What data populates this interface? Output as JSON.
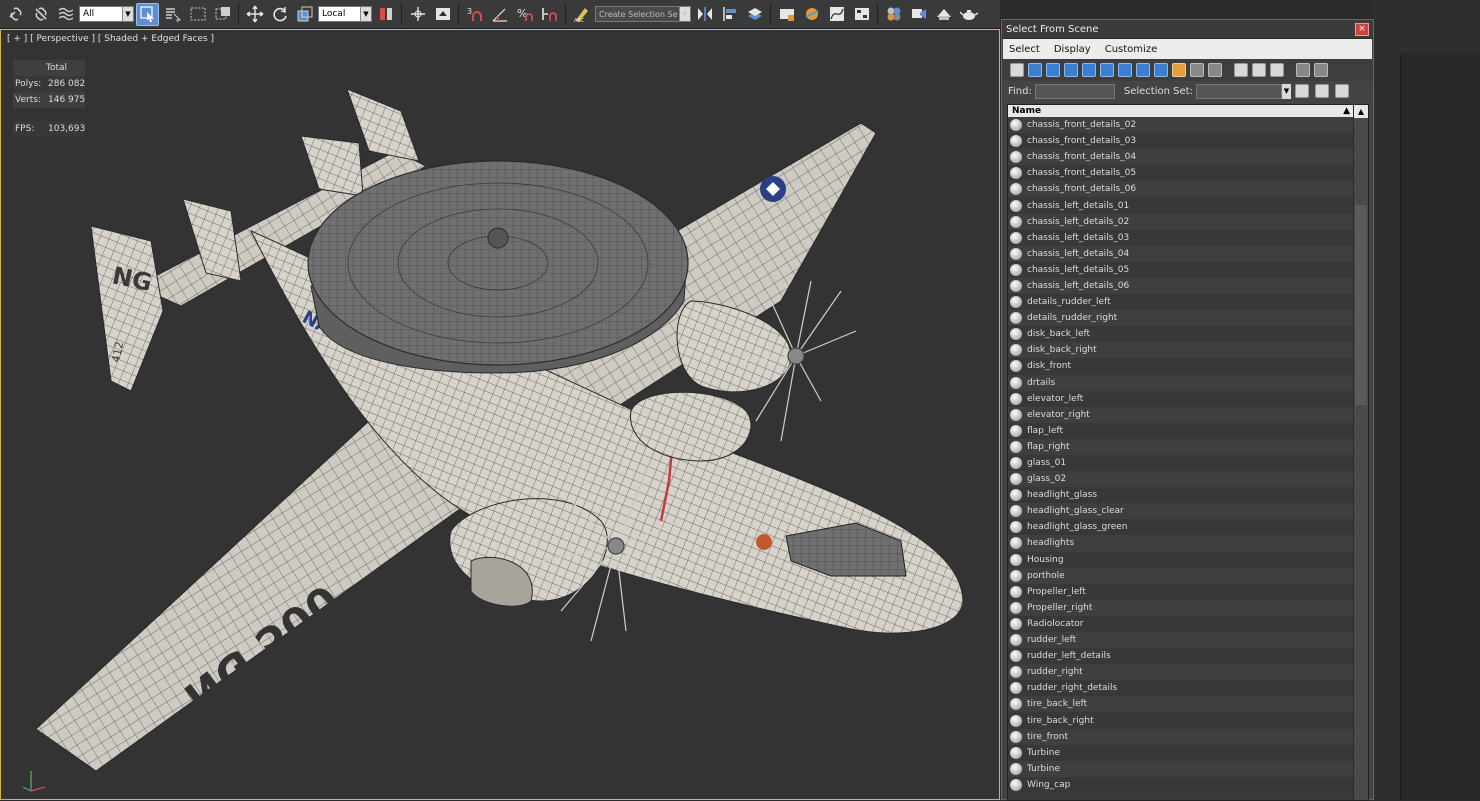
{
  "toolbar": {
    "filter_value": "All",
    "coord_system": "Local",
    "snap_label": "3",
    "selection_set_placeholder": "Create Selection Se"
  },
  "viewport": {
    "label": "[ + ] [ Perspective ] [ Shaded + Edged Faces ]",
    "stats": {
      "total_label": "Total",
      "polys_label": "Polys:",
      "polys_value": "286 082",
      "verts_label": "Verts:",
      "verts_value": "146 975",
      "fps_label": "FPS:",
      "fps_value": "103,693"
    },
    "decals": {
      "tail_code": "NG",
      "tail_number": "412",
      "wing_code": "NG 500",
      "fuselage_text": "NAVY"
    }
  },
  "dialog": {
    "title": "Select From Scene",
    "close": "×",
    "menu": [
      "Select",
      "Display",
      "Customize"
    ],
    "find_label": "Find:",
    "selection_set_label": "Selection Set:",
    "column_header": "Name",
    "items": [
      "chassis_front_details_02",
      "chassis_front_details_03",
      "chassis_front_details_04",
      "chassis_front_details_05",
      "chassis_front_details_06",
      "chassis_left_details_01",
      "chassis_left_details_02",
      "chassis_left_details_03",
      "chassis_left_details_04",
      "chassis_left_details_05",
      "chassis_left_details_06",
      "details_rudder_left",
      "details_rudder_right",
      "disk_back_left",
      "disk_back_right",
      "disk_front",
      "drtails",
      "elevator_left",
      "elevator_right",
      "flap_left",
      "flap_right",
      "glass_01",
      "glass_02",
      "headlight_glass",
      "headlight_glass_clear",
      "headlight_glass_green",
      "headlights",
      "Housing",
      "porthole",
      "Propeller_left",
      "Propeller_right",
      "Radiolocator",
      "rudder_left",
      "rudder_left_details",
      "rudder_right",
      "rudder_right_details",
      "tire_back_left",
      "tire_back_right",
      "tire_front",
      "Turbine",
      "Turbine",
      "Wing_cap"
    ]
  }
}
